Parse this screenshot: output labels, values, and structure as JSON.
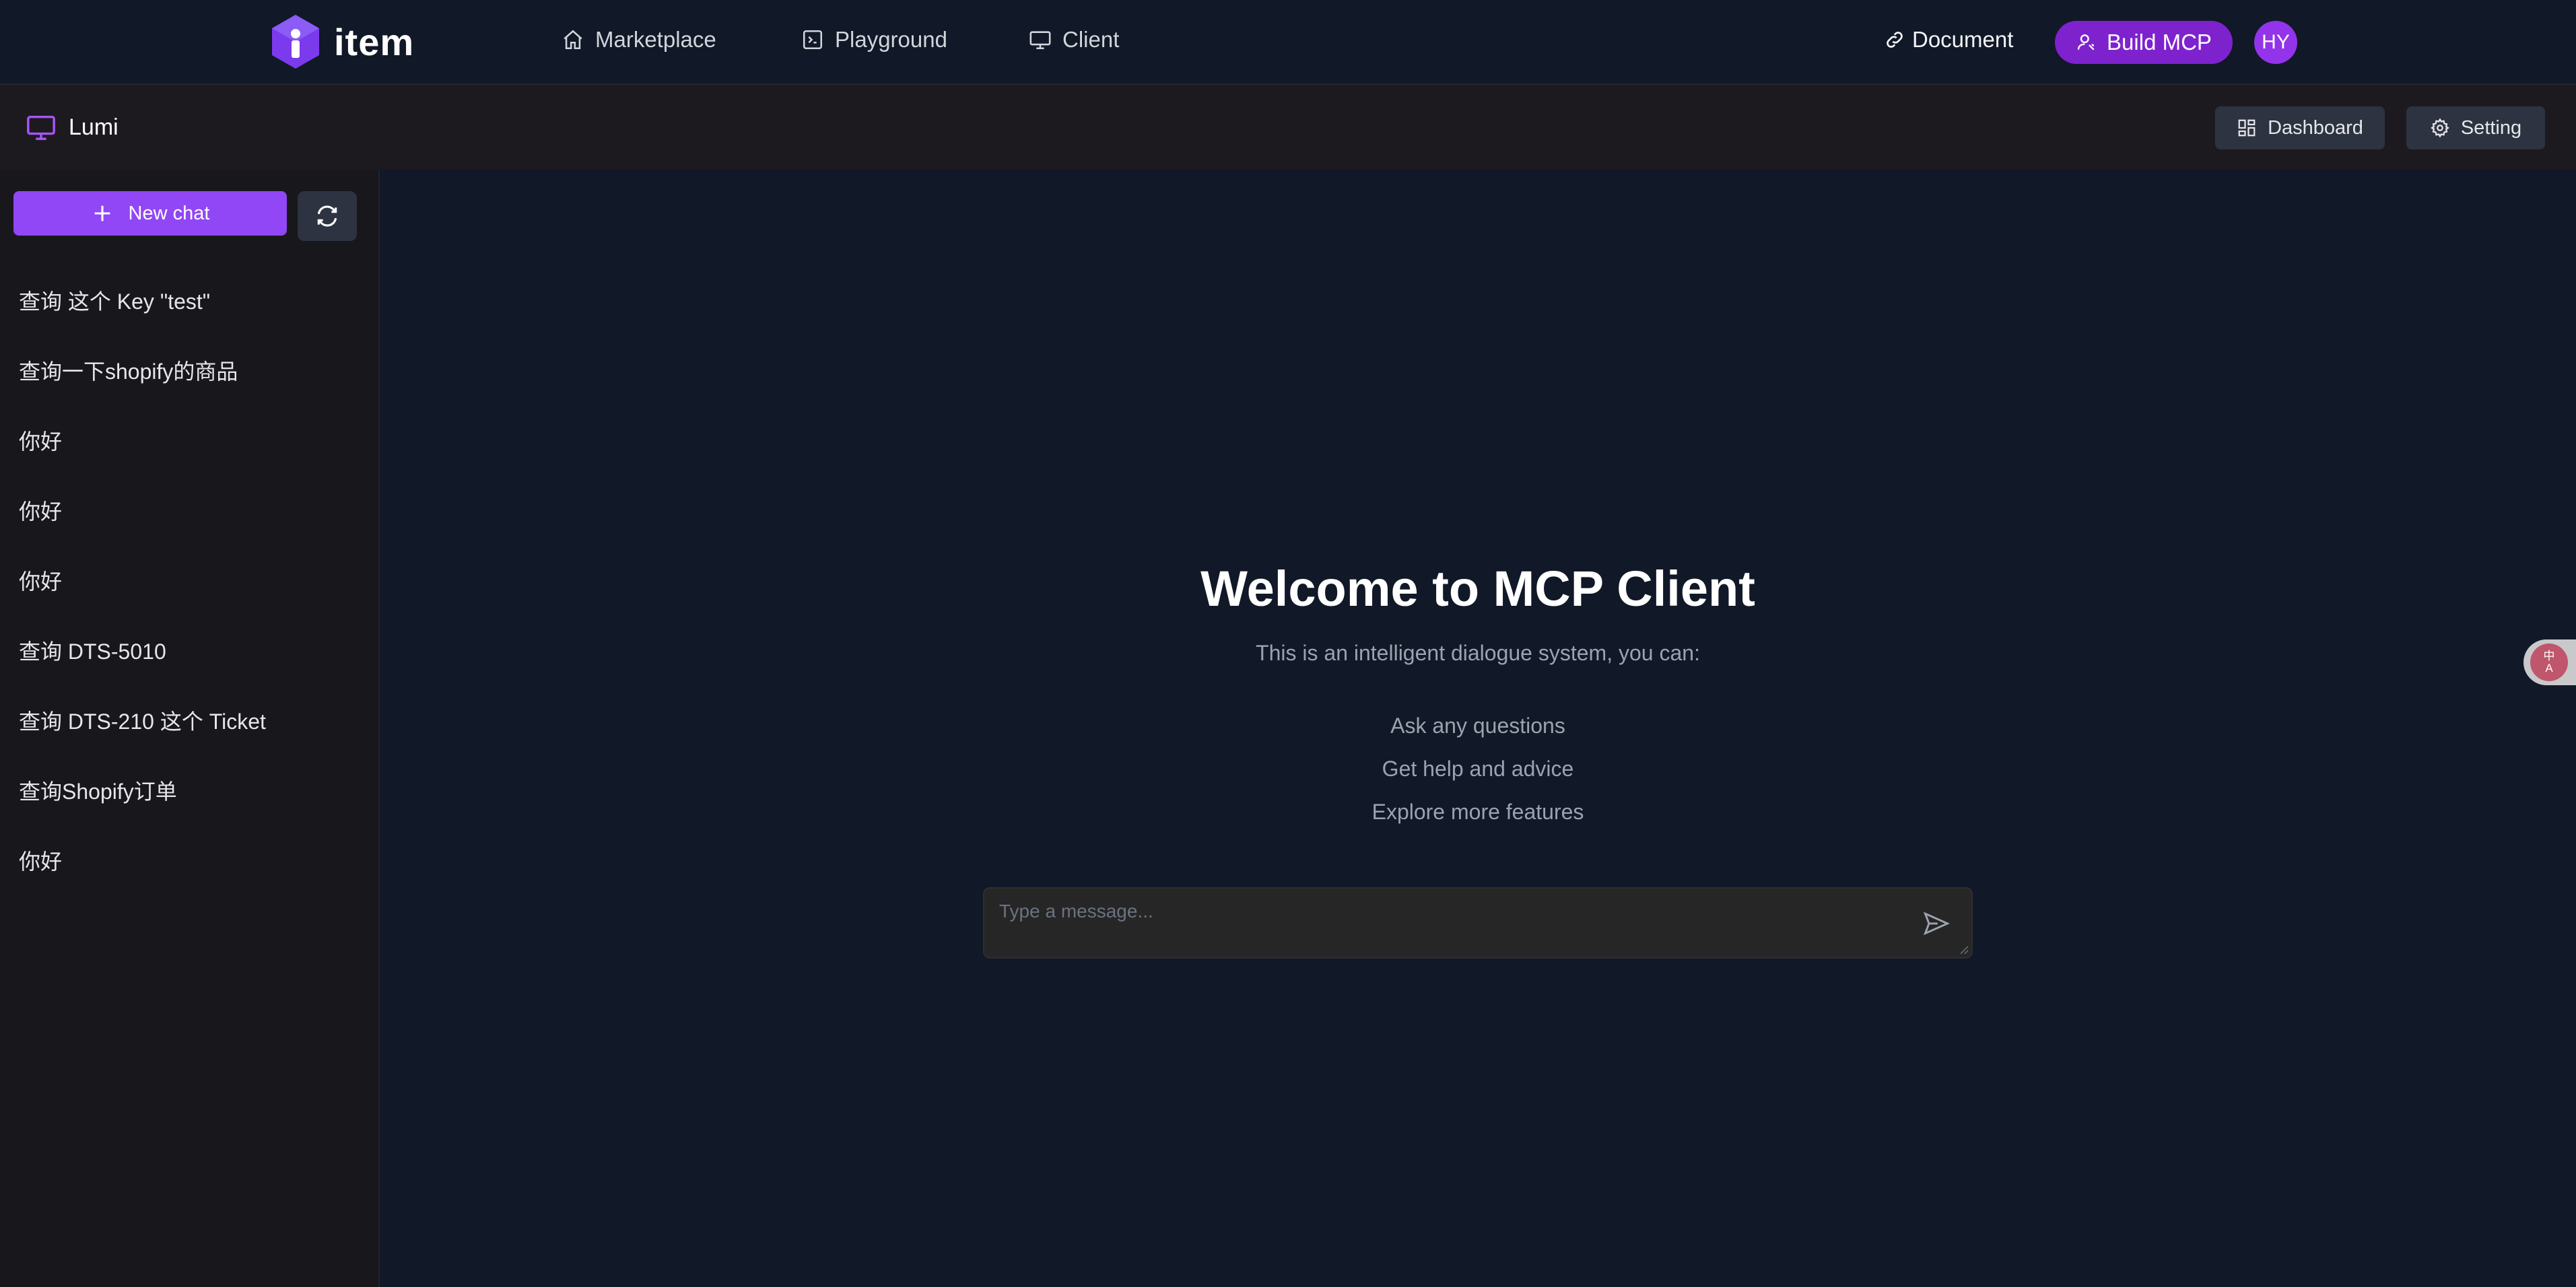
{
  "topnav": {
    "brand": "item",
    "items": [
      {
        "label": "Marketplace",
        "icon": "home-icon"
      },
      {
        "label": "Playground",
        "icon": "terminal-icon"
      },
      {
        "label": "Client",
        "icon": "monitor-icon"
      }
    ],
    "document_label": "Document",
    "build_label": "Build MCP",
    "avatar_initials": "HY"
  },
  "header": {
    "app_name": "Lumi",
    "dashboard_label": "Dashboard",
    "setting_label": "Setting"
  },
  "sidebar": {
    "new_chat_label": "New chat",
    "chats": [
      "查询 这个 Key \"test\"",
      "查询一下shopify的商品",
      "你好",
      "你好",
      "你好",
      "查询 DTS-5010",
      "查询 DTS-210 这个 Ticket",
      "查询Shopify订单",
      "你好"
    ]
  },
  "main": {
    "title": "Welcome to MCP Client",
    "subtitle": "This is an intelligent dialogue system, you can:",
    "features": [
      "Ask any questions",
      "Get help and advice",
      "Explore more features"
    ],
    "input_placeholder": "Type a message..."
  },
  "colors": {
    "accent": "#7e22ce",
    "accent_light": "#9147f5",
    "background": "#111827",
    "sidebar": "#18171c"
  }
}
